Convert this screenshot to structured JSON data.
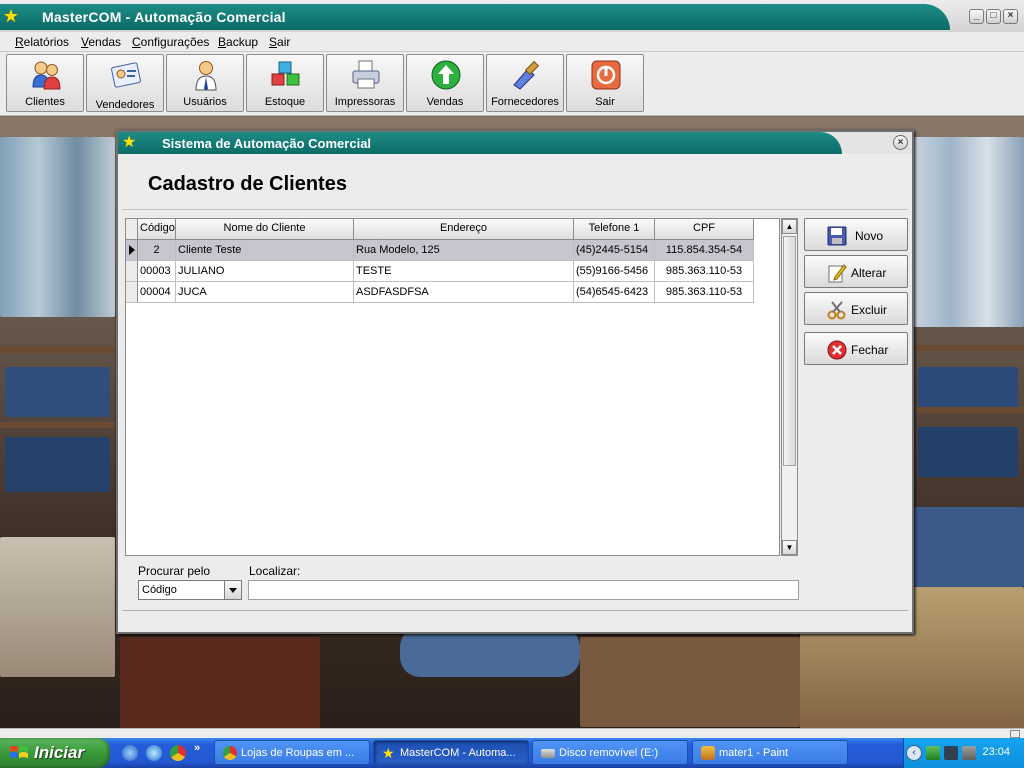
{
  "app": {
    "title": "MasterCOM - Automação Comercial",
    "window_controls": [
      "_",
      "□",
      "×"
    ]
  },
  "menu": [
    "Relatórios",
    "Vendas",
    "Configurações",
    "Backup",
    "Sair"
  ],
  "toolbar": [
    {
      "label": "Clientes",
      "icon": "clients-icon"
    },
    {
      "label": "Vendedores",
      "icon": "sellers-icon"
    },
    {
      "label": "Usuários",
      "icon": "user-icon"
    },
    {
      "label": "Estoque",
      "icon": "stock-cubes-icon"
    },
    {
      "label": "Impressoras",
      "icon": "printer-icon"
    },
    {
      "label": "Vendas",
      "icon": "green-arrow-up-icon"
    },
    {
      "label": "Fornecedores",
      "icon": "supplier-brush-icon"
    },
    {
      "label": "Sair",
      "icon": "exit-power-icon"
    }
  ],
  "dialog": {
    "title": "Sistema de Automação Comercial",
    "heading": "Cadastro de Clientes",
    "close": "×",
    "columns": [
      "Código",
      "Nome do Cliente",
      "Endereço",
      "Telefone 1",
      "CPF"
    ],
    "rows": [
      {
        "codigo": "2",
        "nome": "Cliente Teste",
        "endereco": "Rua Modelo, 125",
        "telefone": "(45)2445-5154",
        "cpf": "115.854.354-54",
        "selected": true
      },
      {
        "codigo": "00003",
        "nome": "JULIANO",
        "endereco": "TESTE",
        "telefone": "(55)9166-5456",
        "cpf": "985.363.110-53",
        "selected": false
      },
      {
        "codigo": "00004",
        "nome": "JUCA",
        "endereco": "ASDFASDFSA",
        "telefone": "(54)6545-6423",
        "cpf": "985.363.110-53",
        "selected": false
      }
    ],
    "buttons": {
      "novo": "Novo",
      "alterar": "Alterar",
      "excluir": "Excluir",
      "fechar": "Fechar"
    },
    "search": {
      "procurar_label": "Procurar pelo",
      "procurar_value": "Código",
      "localizar_label": "Localizar:",
      "localizar_value": ""
    }
  },
  "taskbar": {
    "start": "Iniciar",
    "more": "»",
    "tasks": [
      {
        "label": "Lojas de Roupas em ...",
        "icon": "chrome-icon"
      },
      {
        "label": "MasterCOM - Automa...",
        "icon": "star-icon",
        "active": true
      },
      {
        "label": "Disco removível (E:)",
        "icon": "drive-icon"
      },
      {
        "label": "mater1 - Paint",
        "icon": "paint-icon"
      }
    ],
    "clock": "23:04"
  },
  "colors": {
    "title_teal": "#0c6b67",
    "taskbar_blue": "#245edb",
    "start_green": "#3a9a3a"
  }
}
